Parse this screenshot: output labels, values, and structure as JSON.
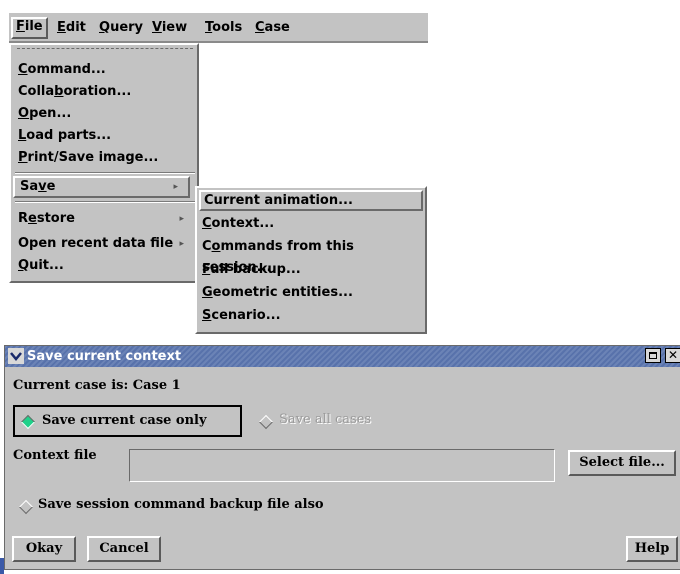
{
  "menubar": {
    "items": [
      {
        "label": "File",
        "u": "F",
        "rest": "ile"
      },
      {
        "label": "Edit",
        "u": "E",
        "rest": "dit"
      },
      {
        "label": "Query",
        "u": "Q",
        "rest": "uery"
      },
      {
        "label": "View",
        "u": "V",
        "rest": "iew"
      },
      {
        "label": "Tools",
        "u": "T",
        "rest": "ools"
      },
      {
        "label": "Case",
        "u": "C",
        "rest": "ase"
      }
    ]
  },
  "file_menu": {
    "items": [
      {
        "label": "Command...",
        "pre": "",
        "u": "C",
        "post": "ommand..."
      },
      {
        "label": "Collaboration...",
        "pre": "Colla",
        "u": "b",
        "post": "oration..."
      },
      {
        "label": "Open...",
        "pre": "",
        "u": "O",
        "post": "pen..."
      },
      {
        "label": "Load parts...",
        "pre": "",
        "u": "L",
        "post": "oad parts..."
      },
      {
        "label": "Print/Save image...",
        "pre": "",
        "u": "P",
        "post": "rint/Save image..."
      },
      {
        "label": "Save",
        "pre": "Sa",
        "u": "v",
        "post": "e"
      },
      {
        "label": "Restore",
        "pre": "R",
        "u": "e",
        "post": "store"
      },
      {
        "label": "Open recent data file",
        "pre": "Open recent data file",
        "u": "",
        "post": ""
      },
      {
        "label": "Quit...",
        "pre": "",
        "u": "Q",
        "post": "uit..."
      }
    ],
    "arrow_glyph": "▸"
  },
  "save_submenu": {
    "items": [
      {
        "label": "Current animation...",
        "pre": "Current animation...",
        "u": "",
        "post": ""
      },
      {
        "label": "Context...",
        "pre": "",
        "u": "C",
        "post": "ontext..."
      },
      {
        "label": "Commands from this session...",
        "pre": "C",
        "u": "o",
        "post": "mmands from this session..."
      },
      {
        "label": "Full backup...",
        "pre": "",
        "u": "F",
        "post": "ull backup..."
      },
      {
        "label": "Geometric entities...",
        "pre": "",
        "u": "G",
        "post": "eometric entities..."
      },
      {
        "label": "Scenario...",
        "pre": "",
        "u": "S",
        "post": "cenario..."
      }
    ]
  },
  "dialog": {
    "title": "Save current context",
    "current_case": "Current case is: Case 1",
    "radio_current": "Save current case only",
    "radio_all": "Save all cases",
    "context_file_label": "Context file",
    "context_file_value": "",
    "select_file": "Select file...",
    "backup_label": "Save session command backup file also",
    "okay": "Okay",
    "cancel": "Cancel",
    "help": "Help"
  },
  "colors": {
    "panel": "#c3c3c3",
    "title_bar": "#5f78b0",
    "radio_selected": "#1fd18a"
  }
}
